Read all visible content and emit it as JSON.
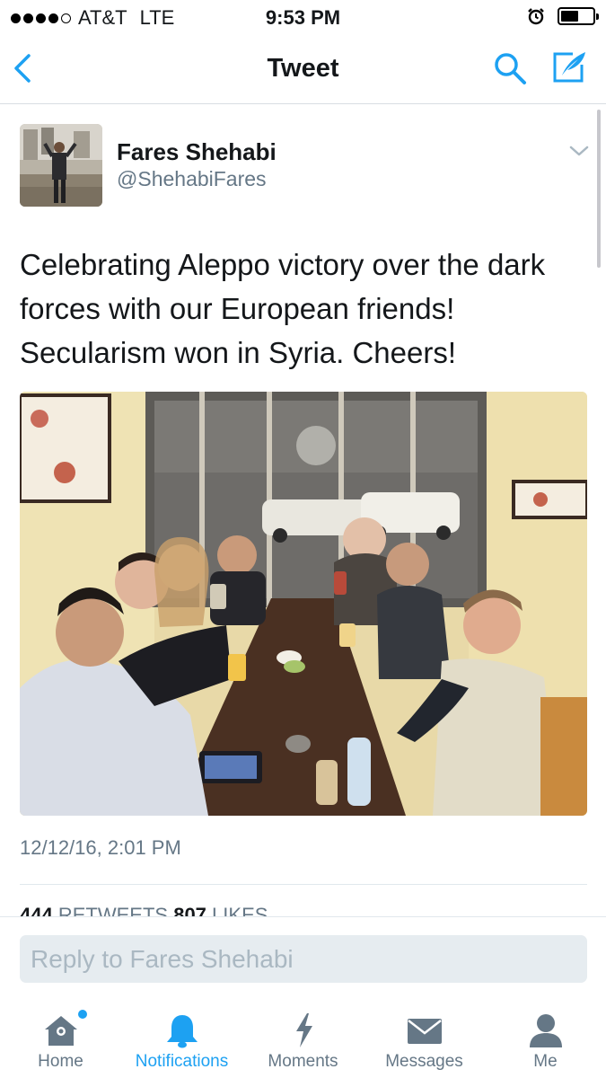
{
  "status_bar": {
    "carrier": "AT&T",
    "network": "LTE",
    "time": "9:53 PM",
    "signal_bars": 4,
    "signal_max": 5,
    "battery_level": 0.55
  },
  "nav": {
    "title": "Tweet",
    "back_icon": "chevron-left-icon",
    "search_icon": "search-icon",
    "compose_icon": "compose-icon"
  },
  "tweet": {
    "author_name": "Fares Shehabi",
    "author_handle": "@ShehabiFares",
    "text": "Celebrating Aleppo victory over the dark forces with our European friends! Secularism won in Syria. Cheers!",
    "timestamp": "12/12/16, 2:01 PM",
    "retweets_count": "444",
    "retweets_label": "RETWEETS",
    "likes_count": "807",
    "likes_label": "LIKES"
  },
  "reply": {
    "placeholder": "Reply to Fares Shehabi"
  },
  "tabs": [
    {
      "label": "Home",
      "icon": "home-icon",
      "has_badge": true
    },
    {
      "label": "Notifications",
      "icon": "bell-icon",
      "active": true
    },
    {
      "label": "Moments",
      "icon": "lightning-icon"
    },
    {
      "label": "Messages",
      "icon": "envelope-icon"
    },
    {
      "label": "Me",
      "icon": "person-icon"
    }
  ],
  "colors": {
    "accent": "#1da1f2",
    "secondary_text": "#657786",
    "primary_text": "#14171a",
    "reply_field_bg": "#e6ecf0"
  }
}
